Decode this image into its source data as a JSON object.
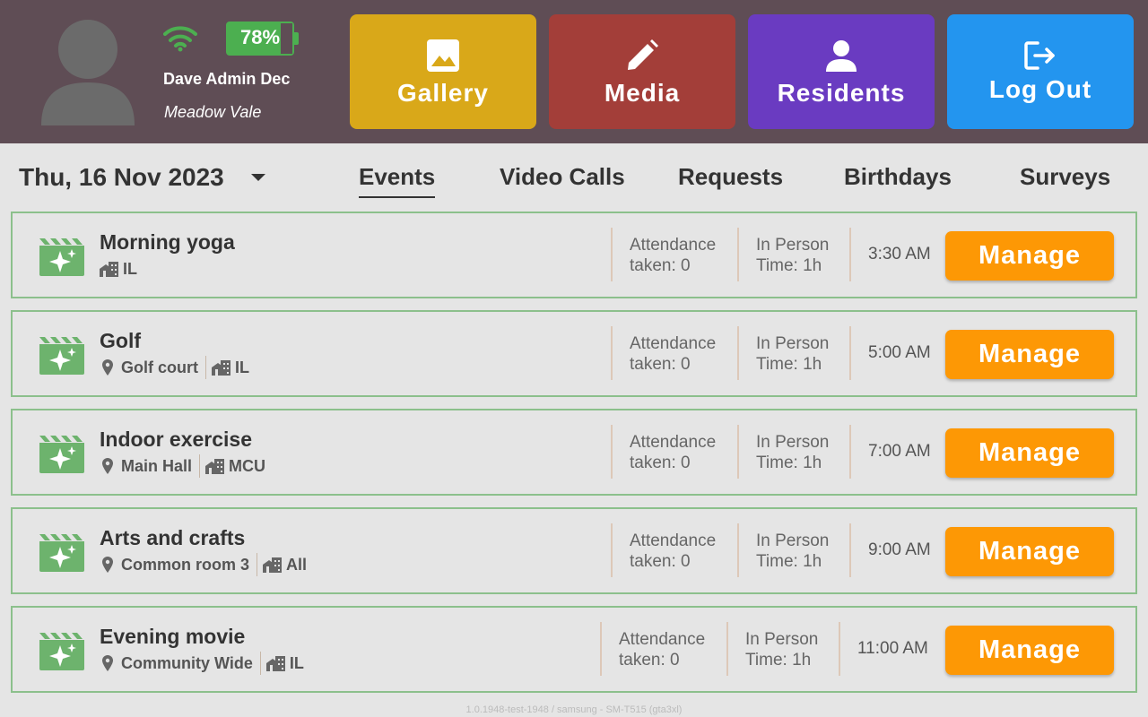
{
  "header": {
    "battery": "78%",
    "user_name": "Dave Admin Dec",
    "facility": "Meadow Vale",
    "nav": {
      "gallery": "Gallery",
      "media": "Media",
      "residents": "Residents",
      "logout": "Log Out"
    },
    "colors": {
      "gallery": "#d9a819",
      "media": "#a33e39",
      "residents": "#6a3bc1",
      "logout": "#2395ef",
      "header_bg": "#5f4d55"
    }
  },
  "date": "Thu, 16 Nov 2023",
  "tabs": {
    "events": "Events",
    "video_calls": "Video Calls",
    "requests": "Requests",
    "birthdays": "Birthdays",
    "surveys": "Surveys",
    "active": "Events"
  },
  "events": [
    {
      "title": "Morning yoga",
      "location": "",
      "group": "IL",
      "attendance_1": "Attendance",
      "attendance_2": "taken: 0",
      "mode_1": "In Person",
      "mode_2": "Time: 1h",
      "time": "3:30 AM",
      "button": "Manage"
    },
    {
      "title": "Golf",
      "location": "Golf court",
      "group": "IL",
      "attendance_1": "Attendance",
      "attendance_2": "taken: 0",
      "mode_1": "In Person",
      "mode_2": "Time: 1h",
      "time": "5:00 AM",
      "button": "Manage"
    },
    {
      "title": "Indoor exercise",
      "location": "Main Hall",
      "group": "MCU",
      "attendance_1": "Attendance",
      "attendance_2": "taken: 0",
      "mode_1": "In Person",
      "mode_2": "Time: 1h",
      "time": "7:00 AM",
      "button": "Manage"
    },
    {
      "title": "Arts and crafts",
      "location": "Common room 3",
      "group": "All",
      "attendance_1": "Attendance",
      "attendance_2": "taken: 0",
      "mode_1": "In Person",
      "mode_2": "Time: 1h",
      "time": "9:00 AM",
      "button": "Manage"
    },
    {
      "title": "Evening movie",
      "location": "Community Wide",
      "group": "IL",
      "attendance_1": "Attendance",
      "attendance_2": "taken: 0",
      "mode_1": "In Person",
      "mode_2": "Time: 1h",
      "time": "11:00 AM",
      "button": "Manage"
    }
  ],
  "icons": {
    "avatar": "user-avatar-icon",
    "wifi": "wifi-icon",
    "battery": "battery-icon",
    "gallery": "image-icon",
    "media": "pencil-icon",
    "residents": "person-icon",
    "logout": "logout-icon",
    "event": "movie-clapper-sparkle-icon",
    "location": "map-pin-icon",
    "group": "building-icon",
    "dropdown": "caret-down-icon"
  },
  "accent": {
    "card_border": "#8cc08c",
    "manage_button": "#fd9805",
    "icon_green": "#6db36d"
  },
  "footer": "1.0.1948-test-1948 / samsung - SM-T515 (gta3xl)"
}
